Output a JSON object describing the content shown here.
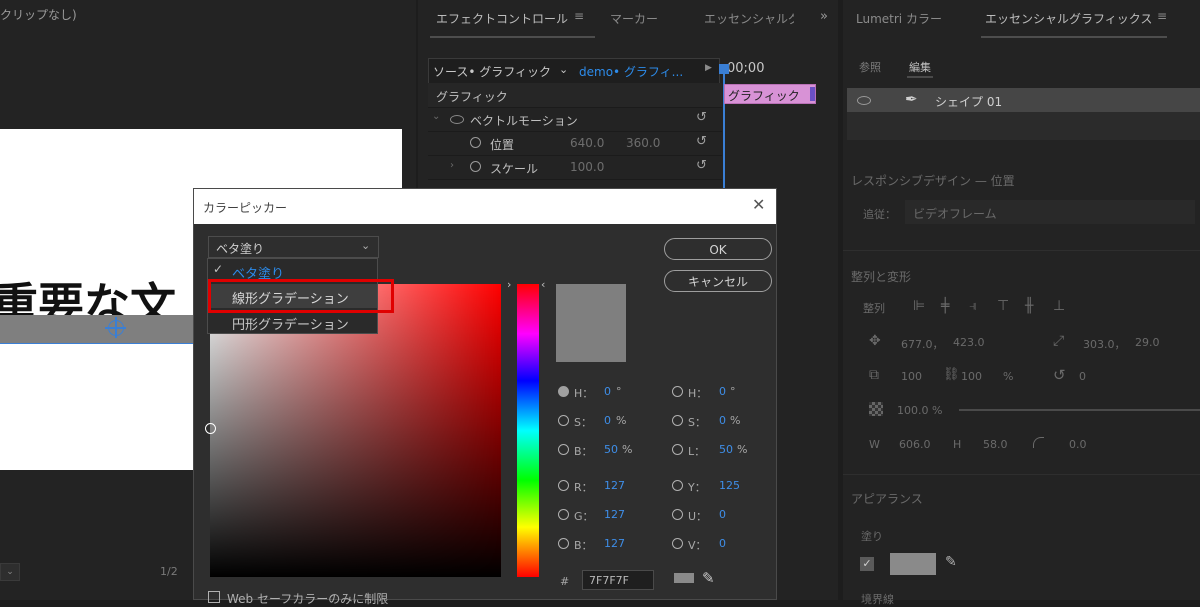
{
  "program": {
    "clip_text": "クリップなし)",
    "overlay_text": "重要な文",
    "page_count": "1/2"
  },
  "effects_panel": {
    "tabs": [
      "エフェクトコントロール",
      "マーカー",
      "エッセンシャルグ"
    ],
    "source_label": "ソース• グラフィック",
    "sequence_label": "demo• グラフィ...",
    "timecode": "00;00",
    "clip_label": "グラフィック",
    "section_label": "グラフィック",
    "vector_motion": "ベクトルモーション",
    "position_label": "位置",
    "position_x": "640.0",
    "position_y": "360.0",
    "scale_label": "スケール",
    "scale_value": "100.0"
  },
  "essential": {
    "tabs": [
      "Lumetri カラー",
      "エッセンシャルグラフィックス"
    ],
    "subtabs": [
      "参照",
      "編集"
    ],
    "layer_name": "シェイプ 01",
    "responsive_title": "レスポンシブデザイン — 位置",
    "follow_label": "追従：",
    "follow_value": "ビデオフレーム",
    "align_title": "整列と変形",
    "align_label": "整列",
    "pos_x": "677.0，",
    "pos_y": "423.0",
    "anchor_x": "303.0，",
    "anchor_y": "29.0",
    "scale_w": "100",
    "scale_h": "100",
    "scale_unit": "%",
    "rotation": "0",
    "opacity": "100.0 %",
    "w_label": "W",
    "w_value": "606.0",
    "h_label": "H",
    "h_value": "58.0",
    "corner_value": "0.0",
    "appearance_title": "アピアランス",
    "fill_label": "塗り",
    "stroke_label": "境界線"
  },
  "picker": {
    "title": "カラーピッカー",
    "fill_type_selected": "ベタ塗り",
    "dropdown_options": [
      "ベタ塗り",
      "線形グラデーション",
      "円形グラデーション"
    ],
    "ok_label": "OK",
    "cancel_label": "キャンセル",
    "hsb_fields": [
      {
        "label": "H：",
        "value": "0",
        "unit": "°"
      },
      {
        "label": "S：",
        "value": "0",
        "unit": "%"
      },
      {
        "label": "B：",
        "value": "50",
        "unit": "%"
      }
    ],
    "hsl_fields": [
      {
        "label": "H：",
        "value": "0",
        "unit": "°"
      },
      {
        "label": "S：",
        "value": "0",
        "unit": "%"
      },
      {
        "label": "L：",
        "value": "50",
        "unit": "%"
      }
    ],
    "rgb_fields": [
      {
        "label": "R：",
        "value": "127"
      },
      {
        "label": "G：",
        "value": "127"
      },
      {
        "label": "B：",
        "value": "127"
      }
    ],
    "yuv_fields": [
      {
        "label": "Y：",
        "value": "125"
      },
      {
        "label": "U：",
        "value": "0"
      },
      {
        "label": "V：",
        "value": "0"
      }
    ],
    "hash_label": "#",
    "hex_value": "7F7F7F",
    "web_safe_label": "Web セーフカラーのみに制限",
    "current_color": "#7f7f7f",
    "highlight_color": "#e00000"
  }
}
